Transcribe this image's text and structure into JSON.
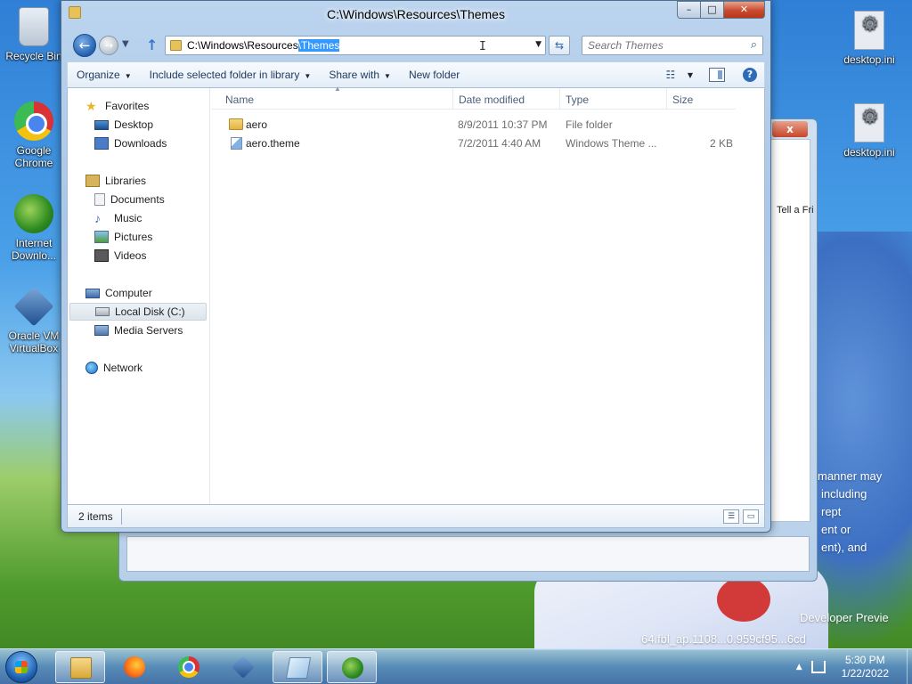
{
  "desktop": {
    "icons": [
      {
        "label": "Recycle Bin"
      },
      {
        "label": "Google Chrome"
      },
      {
        "label": "Internet Downlo..."
      },
      {
        "label": "Oracle VM VirtualBox"
      },
      {
        "label": "desktop.ini"
      },
      {
        "label": "desktop.ini"
      }
    ],
    "wallpaper_text": {
      "line1": "manner may",
      "line2": "including",
      "line3": "rept",
      "line4": "ent or",
      "line5": "ent), and",
      "line6": "Developer Previe",
      "line7": "64.fbl_ap.1108...0.959cf95...6cd"
    }
  },
  "background_window": {
    "close_label": "x",
    "tell_label": "Tell a Fri"
  },
  "window": {
    "title": "C:\\Windows\\Resources\\Themes",
    "caption": {
      "minimize": "–",
      "maximize": "□",
      "close": "✕"
    },
    "address": {
      "prefix": "C:\\Windows\\Resources",
      "selected": "\\Themes"
    },
    "search": {
      "placeholder": "Search Themes"
    },
    "toolbar": {
      "organize": "Organize",
      "include": "Include selected folder in library",
      "share": "Share with",
      "new_folder": "New folder",
      "help": "?"
    },
    "nav": {
      "favorites": "Favorites",
      "desktop": "Desktop",
      "downloads": "Downloads",
      "libraries": "Libraries",
      "documents": "Documents",
      "music": "Music",
      "pictures": "Pictures",
      "videos": "Videos",
      "computer": "Computer",
      "local_disk": "Local Disk (C:)",
      "media_servers": "Media Servers",
      "network": "Network"
    },
    "columns": {
      "name": "Name",
      "date": "Date modified",
      "type": "Type",
      "size": "Size"
    },
    "files": [
      {
        "name": "aero",
        "date": "8/9/2011 10:37 PM",
        "type": "File folder",
        "size": ""
      },
      {
        "name": "aero.theme",
        "date": "7/2/2011 4:40 AM",
        "type": "Windows Theme ...",
        "size": "2 KB"
      }
    ],
    "status": {
      "items": "2 items"
    }
  },
  "taskbar": {
    "clock": {
      "time": "5:30 PM",
      "date": "1/22/2022"
    }
  }
}
